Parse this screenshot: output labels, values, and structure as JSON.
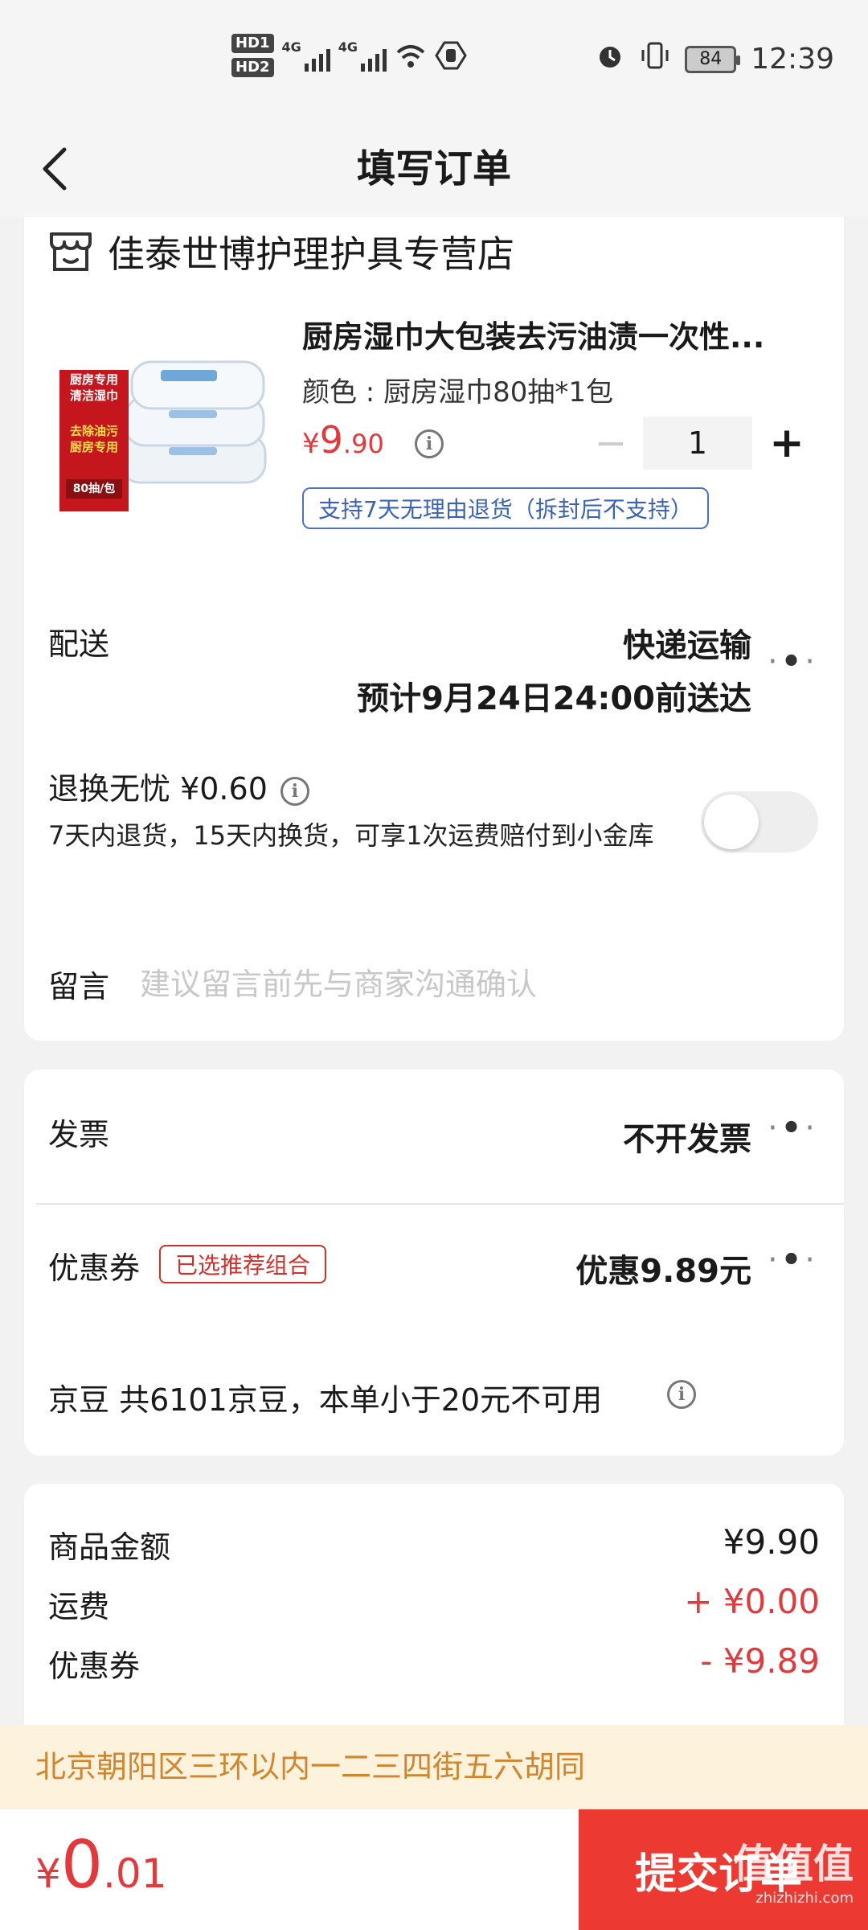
{
  "status_bar": {
    "hd1": "HD1",
    "hd2": "HD2",
    "network1": "4G",
    "network2": "4G",
    "battery": "84",
    "time": "12:39"
  },
  "header": {
    "title": "填写订单"
  },
  "store": {
    "name": "佳泰世博护理护具专营店"
  },
  "product": {
    "title": "厨房湿巾大包装去污油渍一次性...",
    "spec": "颜色 : 厨房湿巾80抽*1包",
    "price_symbol": "¥",
    "price_int": "9",
    "price_dec": ".90",
    "quantity": "1",
    "minus_label": "−",
    "plus_label": "+",
    "return_policy": "支持7天无理由退货（拆封后不支持）",
    "image_labels": {
      "top": "厨房专用\n清洁湿巾",
      "middle": "去除油污\n厨房专用",
      "bottom": "80抽/包"
    }
  },
  "delivery": {
    "label": "配送",
    "method": "快递运输",
    "eta": "预计9月24日24:00前送达"
  },
  "return_worry": {
    "title": "退换无忧 ¥0.60",
    "desc": "7天内退货，15天内换货，可享1次运费赔付到小金库",
    "enabled": false
  },
  "message": {
    "label": "留言",
    "placeholder": "建议留言前先与商家沟通确认"
  },
  "invoice": {
    "label": "发票",
    "value": "不开发票"
  },
  "coupon": {
    "label": "优惠券",
    "tag": "已选推荐组合",
    "value": "优惠9.89元"
  },
  "jingdou": {
    "text": "京豆 共6101京豆，本单小于20元不可用"
  },
  "summary": {
    "rows": [
      {
        "label": "商品金额",
        "value": "¥9.90"
      },
      {
        "label": "运费",
        "value": "+ ¥0.00"
      },
      {
        "label": "优惠券",
        "value": "- ¥9.89"
      }
    ]
  },
  "address": "北京朝阳区三环以内一二三四街五六胡同",
  "footer": {
    "total_symbol": "¥",
    "total_int": "0",
    "total_dec": ".01",
    "submit_label": "提交订单"
  },
  "watermark": {
    "text": "值值值",
    "site": "zhizhizhi.com"
  },
  "colors": {
    "accent_red": "#e4393c",
    "submit_red": "#ec3a32",
    "tag_blue": "#3a62b8",
    "address_orange": "#d0852e"
  }
}
